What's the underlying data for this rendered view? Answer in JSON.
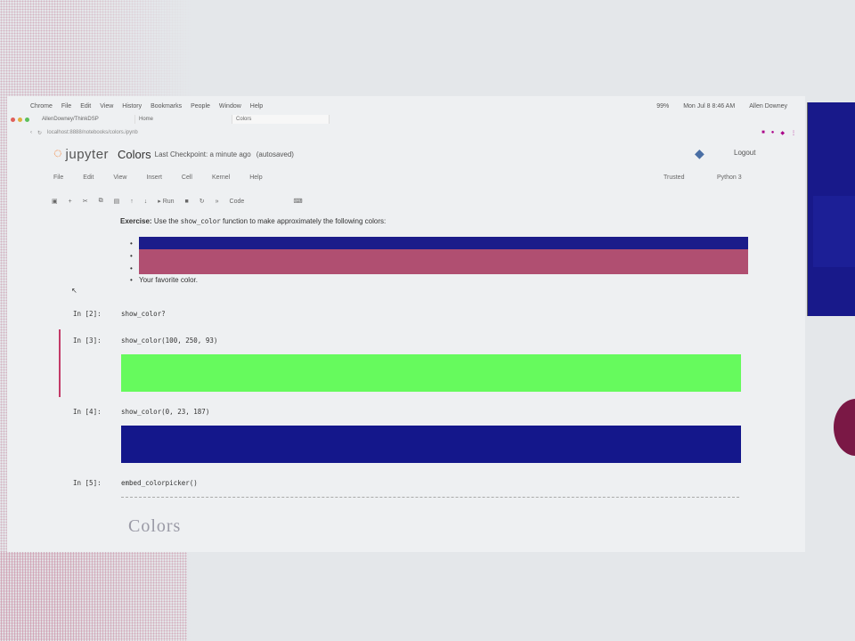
{
  "menubar": {
    "items": [
      "Chrome",
      "File",
      "Edit",
      "View",
      "History",
      "Bookmarks",
      "People",
      "Window",
      "Help"
    ],
    "status": [
      "99%",
      "Mon Jul 8  8:46 AM",
      "Allen Downey"
    ]
  },
  "tabs": [
    "AllenDowney/ThinkDSP",
    "Home",
    "Colors"
  ],
  "url": "localhost:8888/notebooks/colors.ipynb",
  "jupyter": {
    "logo_text": "jupyter",
    "notebook_title": "Colors",
    "checkpoint": "Last Checkpoint: a minute ago",
    "autosaved": "(autosaved)",
    "logout": "Logout",
    "menu": [
      "File",
      "Edit",
      "View",
      "Insert",
      "Cell",
      "Kernel",
      "Help"
    ],
    "trusted": "Trusted",
    "kernel": "Python 3",
    "toolbar": {
      "run": "Run",
      "cell_type": "Code"
    }
  },
  "exercise": {
    "bold": "Exercise:",
    "pre": "Use the",
    "code": "show_color",
    "post": "function to make approximately the following colors:",
    "favorite": "Your favorite color."
  },
  "swatches": [
    "#1b1c8a",
    "#b04f71"
  ],
  "cells": [
    {
      "prompt": "In [2]:",
      "code": "show_color?"
    },
    {
      "prompt": "In [3]:",
      "code": "show_color(100, 250, 93)",
      "output_color": "#66fa5d"
    },
    {
      "prompt": "In [4]:",
      "code": "show_color(0, 23, 187)",
      "output_color": "#14178b"
    },
    {
      "prompt": "In [5]:",
      "code": "embed_colorpicker()"
    }
  ],
  "picker_text": "Colors"
}
